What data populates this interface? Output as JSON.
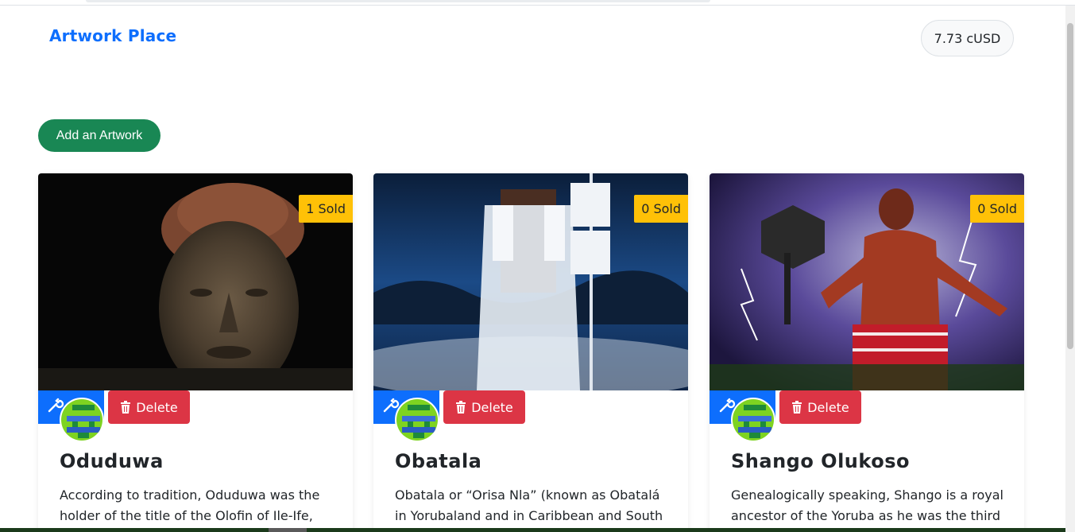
{
  "brand": "Artwork Place",
  "balance": "7.73 cUSD",
  "add_button": "Add an Artwork",
  "cards": [
    {
      "sold": "1 Sold",
      "delete_label": "Delete",
      "title": "Oduduwa",
      "description": "According to tradition, Oduduwa was the holder of the title of the Olofin of Ile-Ife,",
      "image_icon": "bronze-head-sculpture"
    },
    {
      "sold": "0 Sold",
      "delete_label": "Delete",
      "title": "Obatala",
      "description": "Obatala or “Orisa Nla” (known as Obatalá in Yorubaland and in Caribbean and South",
      "image_icon": "white-robed-figure"
    },
    {
      "sold": "0 Sold",
      "delete_label": "Delete",
      "title": "Shango Olukoso",
      "description": "Genealogically speaking, Shango is a royal ancestor of the Yoruba as he was the third",
      "image_icon": "warrior-with-axe"
    }
  ],
  "colors": {
    "primary": "#0d6efd",
    "success": "#198754",
    "danger": "#dc3545",
    "warning": "#ffc107"
  }
}
